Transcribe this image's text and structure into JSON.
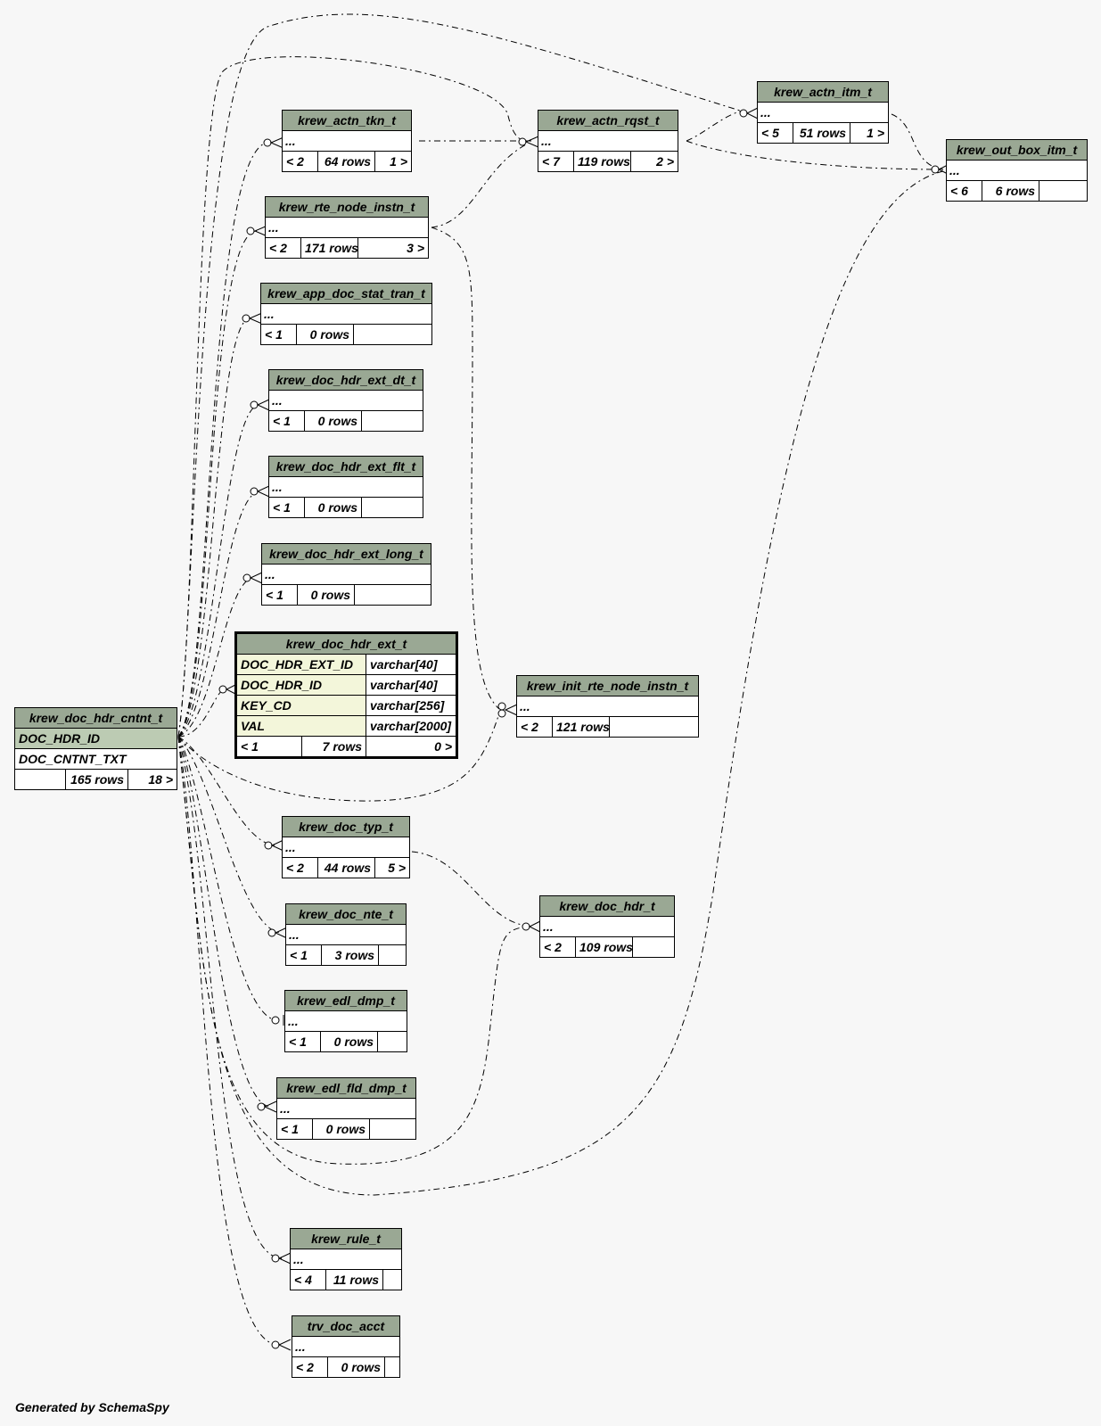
{
  "footer": "Generated by SchemaSpy",
  "focus_table": {
    "name": "krew_doc_hdr_ext_t",
    "columns": [
      {
        "name": "DOC_HDR_EXT_ID",
        "type": "varchar[40]"
      },
      {
        "name": "DOC_HDR_ID",
        "type": "varchar[40]"
      },
      {
        "name": "KEY_CD",
        "type": "varchar[256]"
      },
      {
        "name": "VAL",
        "type": "varchar[2000]"
      }
    ],
    "parents": "< 1",
    "rows": "7 rows",
    "children": "0 >"
  },
  "parent_table": {
    "name": "krew_doc_hdr_cntnt_t",
    "columns": [
      "DOC_HDR_ID",
      "DOC_CNTNT_TXT"
    ],
    "parents": "",
    "rows": "165 rows",
    "children": "18 >"
  },
  "tables": [
    {
      "name": "krew_actn_tkn_t",
      "parents": "< 2",
      "rows": "64 rows",
      "children": "1 >"
    },
    {
      "name": "krew_rte_node_instn_t",
      "parents": "< 2",
      "rows": "171 rows",
      "children": "3 >"
    },
    {
      "name": "krew_app_doc_stat_tran_t",
      "parents": "< 1",
      "rows": "0 rows",
      "children": ""
    },
    {
      "name": "krew_doc_hdr_ext_dt_t",
      "parents": "< 1",
      "rows": "0 rows",
      "children": ""
    },
    {
      "name": "krew_doc_hdr_ext_flt_t",
      "parents": "< 1",
      "rows": "0 rows",
      "children": ""
    },
    {
      "name": "krew_doc_hdr_ext_long_t",
      "parents": "< 1",
      "rows": "0 rows",
      "children": ""
    },
    {
      "name": "krew_doc_typ_t",
      "parents": "< 2",
      "rows": "44 rows",
      "children": "5 >"
    },
    {
      "name": "krew_doc_nte_t",
      "parents": "< 1",
      "rows": "3 rows",
      "children": ""
    },
    {
      "name": "krew_edl_dmp_t",
      "parents": "< 1",
      "rows": "0 rows",
      "children": ""
    },
    {
      "name": "krew_edl_fld_dmp_t",
      "parents": "< 1",
      "rows": "0 rows",
      "children": ""
    },
    {
      "name": "krew_rule_t",
      "parents": "< 4",
      "rows": "11 rows",
      "children": ""
    },
    {
      "name": "trv_doc_acct",
      "parents": "< 2",
      "rows": "0 rows",
      "children": ""
    },
    {
      "name": "krew_actn_rqst_t",
      "parents": "< 7",
      "rows": "119 rows",
      "children": "2 >"
    },
    {
      "name": "krew_actn_itm_t",
      "parents": "< 5",
      "rows": "51 rows",
      "children": "1 >"
    },
    {
      "name": "krew_out_box_itm_t",
      "parents": "< 6",
      "rows": "6 rows",
      "children": ""
    },
    {
      "name": "krew_init_rte_node_instn_t",
      "parents": "< 2",
      "rows": "121 rows",
      "children": ""
    },
    {
      "name": "krew_doc_hdr_t",
      "parents": "< 2",
      "rows": "109 rows",
      "children": ""
    }
  ],
  "ellipsis": "...",
  "colors": {
    "header": "#9aa894",
    "primary_key": "#bccbb3",
    "foreign_key": "#f3f6da",
    "background": "#f7f7f7"
  }
}
